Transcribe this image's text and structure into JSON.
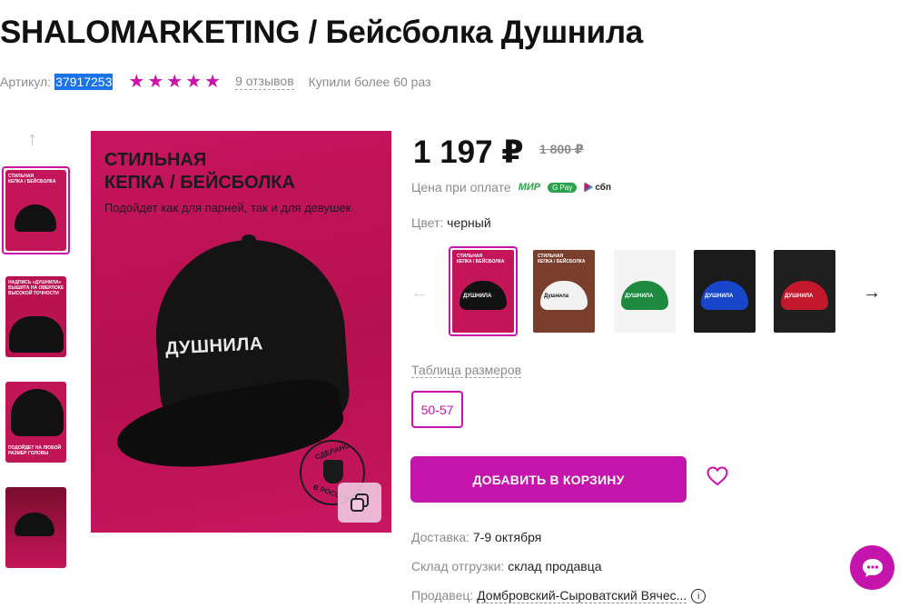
{
  "product": {
    "title": "SHALOMARKETING / Бейсболка Душнила",
    "sku_label": "Артикул:",
    "sku_value": "37917253",
    "rating_stars": 5,
    "reviews": "9 отзывов",
    "bought": "Купили более 60 раз"
  },
  "gallery": {
    "main_heading_line1": "СТИЛЬНАЯ",
    "main_heading_line2": "КЕПКА / БЕЙСБОЛКА",
    "main_subtitle": "Подойдет как для парней, так и для девушек",
    "cap_text": "ДУШНИЛА",
    "stamp_top": "СДЕЛАНО",
    "stamp_bottom": "В РОССИИ"
  },
  "pricing": {
    "price": "1 197 ₽",
    "old_price": "1 800 ₽",
    "pay_label": "Цена при оплате",
    "pay_methods": [
      "МИР",
      "G Pay",
      "сбп"
    ]
  },
  "color": {
    "label": "Цвет:",
    "value": "черный",
    "options": [
      {
        "name": "black",
        "bg": "#c41558",
        "cap": "#111111",
        "text": "#ffffff"
      },
      {
        "name": "white",
        "bg": "#7a3f2c",
        "cap": "#f2f2f2",
        "text": "#1a1a1a"
      },
      {
        "name": "green",
        "bg": "#f4f4f4",
        "cap": "#1d8a3f",
        "text": "#ffffff"
      },
      {
        "name": "blue",
        "bg": "#1b1b1b",
        "cap": "#1846c9",
        "text": "#ffffff"
      },
      {
        "name": "red",
        "bg": "#1f1f1f",
        "cap": "#c3182c",
        "text": "#ffffff"
      }
    ]
  },
  "sizes": {
    "table_link": "Таблица размеров",
    "options": [
      "50-57"
    ]
  },
  "actions": {
    "add_to_cart": "ДОБАВИТЬ В КОРЗИНУ"
  },
  "delivery": {
    "delivery_label": "Доставка:",
    "delivery_value": "7-9 октября",
    "warehouse_label": "Склад отгрузки:",
    "warehouse_value": "склад продавца",
    "seller_label": "Продавец:",
    "seller_value": "Домбровский-Сыроватский Вячес..."
  },
  "colors": {
    "accent": "#cb11ab",
    "button": "#c414ac",
    "promo_bg": "#c41558"
  }
}
